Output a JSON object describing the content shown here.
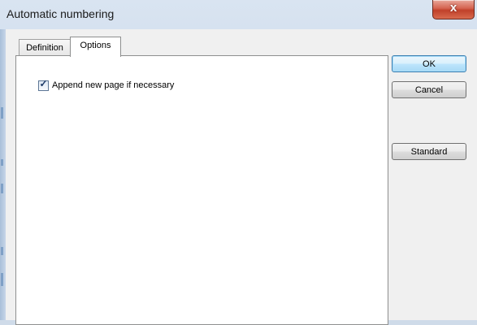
{
  "window": {
    "title": "Automatic numbering",
    "close_symbol": "x"
  },
  "tabs": [
    {
      "label": "Definition",
      "selected": false
    },
    {
      "label": "Options",
      "selected": true
    }
  ],
  "options": {
    "append_checkbox": {
      "label": "Append new page if necessary",
      "checked": true,
      "check_glyph": "✓"
    }
  },
  "buttons": {
    "ok": "OK",
    "cancel": "Cancel",
    "standard": "Standard"
  }
}
